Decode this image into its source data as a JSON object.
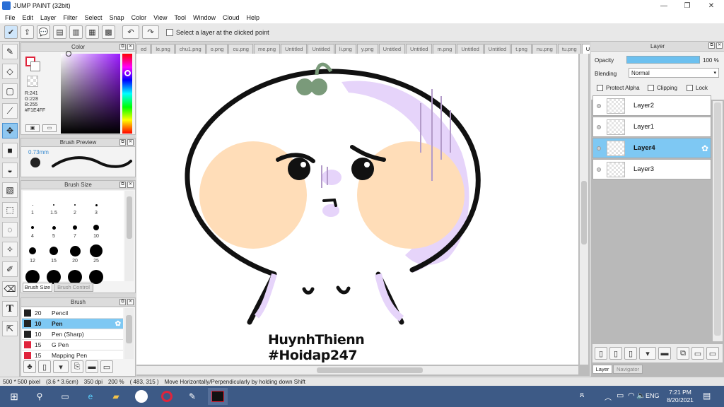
{
  "titlebar": {
    "title": "JUMP PAINT (32bit)",
    "min": "—",
    "max": "❐",
    "close": "✕"
  },
  "menu": [
    "File",
    "Edit",
    "Layer",
    "Filter",
    "Select",
    "Snap",
    "Color",
    "View",
    "Tool",
    "Window",
    "Cloud",
    "Help"
  ],
  "toolbar": {
    "select_layer_label": "Select a layer at the clicked point"
  },
  "color_panel": {
    "title": "Color",
    "r": "R:241",
    "g": "G:228",
    "b": "B:255",
    "hex": "#F1E4FF",
    "primary_color": "#F1E4FF",
    "accent": "#e0243c"
  },
  "brush_preview": {
    "title": "Brush Preview",
    "size": "0.73mm"
  },
  "brush_size": {
    "title": "Brush Size",
    "sizes": [
      "1",
      "1.5",
      "2",
      "3",
      "4",
      "5",
      "7",
      "10",
      "12",
      "15",
      "20",
      "25"
    ],
    "tabs": [
      "Brush Size",
      "Brush Control"
    ]
  },
  "brush_panel": {
    "title": "Brush",
    "items": [
      {
        "size": "20",
        "name": "Pencil",
        "color": "#222222"
      },
      {
        "size": "10",
        "name": "Pen",
        "color": "#222222",
        "selected": true
      },
      {
        "size": "10",
        "name": "Pen (Sharp)",
        "color": "#222222"
      },
      {
        "size": "15",
        "name": "G Pen",
        "color": "#e0243c"
      },
      {
        "size": "15",
        "name": "Mapping Pen",
        "color": "#e0243c"
      }
    ]
  },
  "tabs": [
    "ed",
    "le.png",
    "chu1.png",
    "o.png",
    "cu.png",
    "me.png",
    "Untitled",
    "Untitled",
    "li.png",
    "y.png",
    "Untitled",
    "Untitled",
    "m.png",
    "Untitled",
    "Untitled",
    "t.png",
    "nu.png",
    "tu.png",
    "Untitled"
  ],
  "artwork": {
    "watermark_line1": "HuynhThienn",
    "watermark_line2": "#Hoidap247",
    "cheek_color": "#FFDDB8",
    "shadow_color": "#E6D4FA",
    "sprout_color": "#7A9A7A"
  },
  "layer_panel": {
    "title": "Layer",
    "opacity_label": "Opacity",
    "opacity_value": "100 %",
    "opacity_fraction": 1.0,
    "blending_label": "Blending",
    "blending_value": "Normal",
    "protect_alpha": "Protect Alpha",
    "clipping": "Clipping",
    "lock": "Lock",
    "layers": [
      {
        "name": "Layer2"
      },
      {
        "name": "Layer1"
      },
      {
        "name": "Layer4",
        "selected": true
      },
      {
        "name": "Layer3"
      }
    ],
    "bottom_tabs": [
      "Layer",
      "Navigator"
    ]
  },
  "statusbar": {
    "size": "500 * 500 pixel",
    "cm": "(3.6 * 3.6cm)",
    "dpi": "350 dpi",
    "zoom": "200 %",
    "coords": "( 483, 315 )",
    "hint": "Move Horizontally/Perpendicularly by holding down Shift"
  },
  "taskbar": {
    "lang": "ENG",
    "time": "7:21 PM",
    "date": "8/20/2021"
  }
}
